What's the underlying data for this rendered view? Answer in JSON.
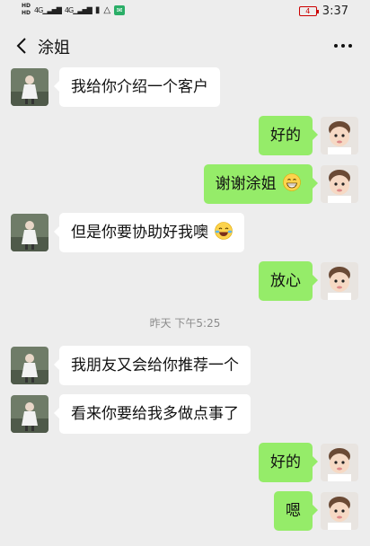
{
  "status_bar": {
    "hd1": "HD",
    "hd2": "HD",
    "signal1": "4G",
    "signal2": "4G",
    "battery": "4",
    "time": "3:37"
  },
  "header": {
    "title": "涂姐"
  },
  "messages": [
    {
      "side": "left",
      "text": "我给你介绍一个客户"
    },
    {
      "side": "right",
      "text": "好的"
    },
    {
      "side": "right",
      "text": "谢谢涂姐",
      "emoji": "grinning-emoji"
    },
    {
      "side": "left",
      "text": "但是你要协助好我噢",
      "emoji": "tears-of-joy-emoji"
    },
    {
      "side": "right",
      "text": "放心"
    },
    {
      "side": "left",
      "text": "我朋友又会给你推荐一个"
    },
    {
      "side": "left",
      "text": "看来你要给我多做点事了"
    },
    {
      "side": "right",
      "text": "好的"
    },
    {
      "side": "right",
      "text": "嗯"
    }
  ],
  "timestamp": "昨天 下午5:25",
  "colors": {
    "background": "#ededed",
    "sent_bubble": "#95ec69",
    "received_bubble": "#ffffff"
  }
}
